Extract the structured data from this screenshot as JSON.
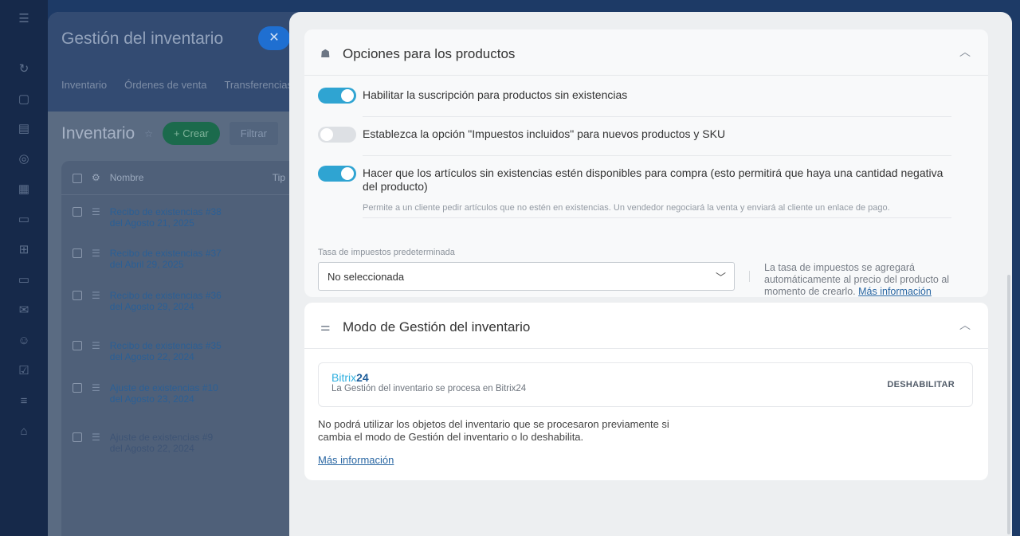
{
  "background": {
    "window_title": "Gestión del inventario",
    "tabs": [
      "Inventario",
      "Órdenes de venta",
      "Transferencias"
    ],
    "page_title": "Inventario",
    "create_label": "+ Crear",
    "filter_label": "Filtrar",
    "columns": {
      "name": "Nombre",
      "type": "Tip"
    },
    "rows": [
      {
        "title": "Recibo de existencias #38",
        "date": "del Agosto 21, 2025"
      },
      {
        "title": "Recibo de existencias #37",
        "date": "del Abril 29, 2025"
      },
      {
        "title": "Recibo de existencias #36",
        "date": "del Agosto 29, 2024"
      },
      {
        "title": "Recibo de existencias #35",
        "date": "del Agosto 22, 2024"
      },
      {
        "title": "Ajuste de existencias #10",
        "date": "del Agosto 23, 2024"
      },
      {
        "title": "Ajuste de existencias #9",
        "date": "del Agosto 22, 2024"
      }
    ]
  },
  "products_section": {
    "title": "Opciones para los productos",
    "options": [
      {
        "label": "Habilitar la suscripción para productos sin existencias",
        "enabled": true
      },
      {
        "label": "Establezca la opción \"Impuestos incluidos\" para nuevos productos y SKU",
        "enabled": false
      },
      {
        "label": "Hacer que los artículos sin existencias estén disponibles para compra (esto permitirá que haya una cantidad negativa del producto)",
        "hint": "Permite a un cliente pedir artículos que no estén en existencias. Un vendedor negociará la venta y enviará al cliente un enlace de pago.",
        "enabled": true
      }
    ],
    "tax_label": "Tasa de impuestos predeterminada",
    "tax_value": "No seleccionada",
    "tax_note": "La tasa de impuestos se agregará automáticamente al precio del producto al momento de crearlo.",
    "tax_link": "Más información"
  },
  "mode_section": {
    "title": "Modo de Gestión del inventario",
    "brand_part1": "Bitrix",
    "brand_part2": "24",
    "description": "La Gestión del inventario se procesa en Bitrix24",
    "disable_label": "DESHABILITAR",
    "warning": "No podrá utilizar los objetos del inventario que se procesaron previamente si cambia el modo de Gestión del inventario o lo deshabilita.",
    "more_link": "Más información"
  },
  "colors": {
    "accent": "#2fa4d2",
    "link": "#2a67a3",
    "brand_light": "#2fb0e0",
    "brand_dark": "#1f5e9a"
  }
}
